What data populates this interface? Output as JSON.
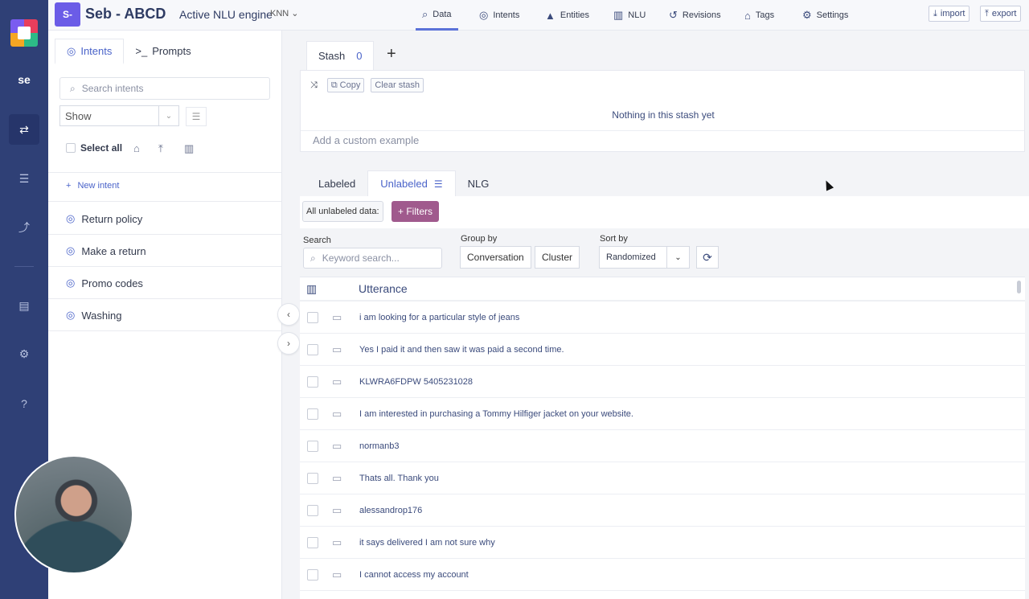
{
  "rail": {
    "workspace_initials": "se",
    "icons": [
      "logo-icon",
      "swap-icon",
      "database-icon",
      "route-icon",
      "report-icon",
      "settings-icon",
      "help-icon"
    ]
  },
  "header": {
    "project_badge": "S-",
    "project_title": "Seb - ABCD",
    "engine_label": "Active NLU engine",
    "engine_value": "KNN",
    "nav": [
      {
        "label": "Data",
        "icon": "search-icon",
        "active": true
      },
      {
        "label": "Intents",
        "icon": "target-icon"
      },
      {
        "label": "Entities",
        "icon": "shapes-icon"
      },
      {
        "label": "NLU",
        "icon": "bar-chart-icon"
      },
      {
        "label": "Revisions",
        "icon": "history-icon"
      },
      {
        "label": "Tags",
        "icon": "tag-icon"
      },
      {
        "label": "Settings",
        "icon": "gear-icon"
      }
    ],
    "import_label": "import",
    "export_label": "export"
  },
  "left_panel": {
    "tabs": [
      {
        "label": "Intents",
        "active": true
      },
      {
        "label": "Prompts"
      }
    ],
    "search_placeholder": "Search intents",
    "show_value": "Show",
    "select_all": "Select all",
    "new_intent": "New intent",
    "intents": [
      "Return policy",
      "Make a return",
      "Promo codes",
      "Washing"
    ]
  },
  "stash": {
    "tab_label": "Stash",
    "count": "0",
    "copy_label": "Copy",
    "clear_label": "Clear stash",
    "empty_text": "Nothing in this stash yet",
    "custom_placeholder": "Add a custom example"
  },
  "data_tabs": [
    {
      "label": "Labeled"
    },
    {
      "label": "Unlabeled",
      "active": true
    },
    {
      "label": "NLG"
    }
  ],
  "filters": {
    "all_label": "All unlabeled data:",
    "filters_btn": "+ Filters"
  },
  "controls": {
    "search_label": "Search",
    "search_placeholder": "Keyword search...",
    "group_label": "Group by",
    "group_options": [
      "Conversation",
      "Cluster"
    ],
    "sort_label": "Sort by",
    "sort_value": "Randomized"
  },
  "table": {
    "header": "Utterance",
    "rows": [
      "i am looking for a particular style of jeans",
      "Yes I paid it and then saw it was paid a second time.",
      "KLWRA6FDPW 5405231028",
      "I am interested in purchasing a Tommy Hilfiger jacket on your website.",
      "normanb3",
      "Thats all. Thank you",
      "alessandrop176",
      "it says delivered I am not sure why",
      "I cannot access my account"
    ]
  },
  "colors": {
    "rail": "#2f4076",
    "accent": "#4a63c9",
    "filters": "#a05a8d",
    "badge": "#6b5ce7"
  }
}
